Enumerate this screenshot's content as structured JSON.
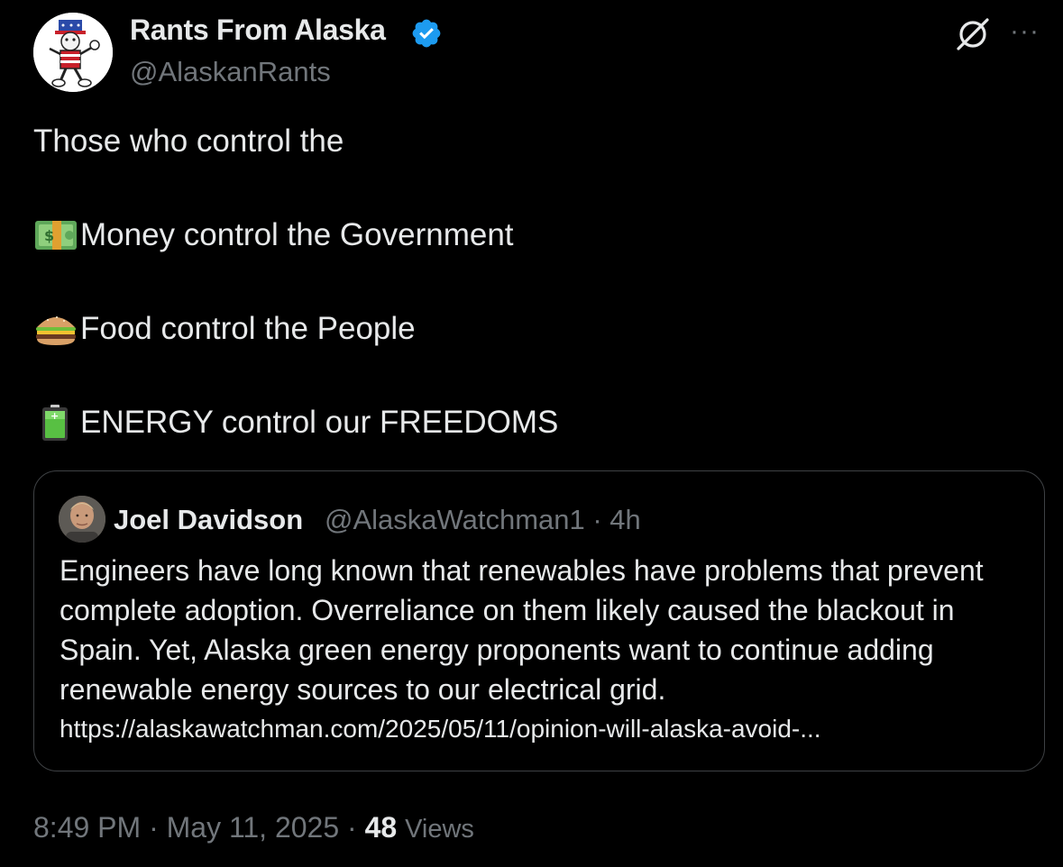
{
  "author": {
    "display_name": "Rants From Alaska",
    "handle": "@AlaskanRants",
    "verified_icon": "verified-badge-icon",
    "badge_color": "#1d9bf0"
  },
  "header_actions": {
    "grok_icon": "grok-icon",
    "more_label": "···"
  },
  "tweet": {
    "lines": [
      {
        "emoji": "",
        "text": "Those who control the"
      },
      {
        "emoji": "money-emoji",
        "text": "Money control the Government"
      },
      {
        "emoji": "burger-emoji",
        "text": "Food control the People"
      },
      {
        "emoji": "battery-emoji",
        "text": "ENERGY control our FREEDOMS"
      }
    ]
  },
  "quote": {
    "name": "Joel Davidson",
    "handle_time": "@AlaskaWatchman1 · 4h",
    "text": "Engineers have long known that renewables have problems that prevent complete adoption. Overreliance on them likely caused the blackout in Spain. Yet, Alaska green energy proponents want to continue adding renewable energy sources to our electrical grid.",
    "link": "https://alaskawatchman.com/2025/05/11/opinion-will-alaska-avoid-..."
  },
  "footer": {
    "timestamp": "8:49 PM · May 11, 2025 · ",
    "views_count": "48",
    "views_label": "Views"
  },
  "colors": {
    "background": "#000000",
    "text": "#e7e9ea",
    "muted": "#71767b",
    "border": "#3e4144",
    "verified": "#1d9bf0"
  }
}
